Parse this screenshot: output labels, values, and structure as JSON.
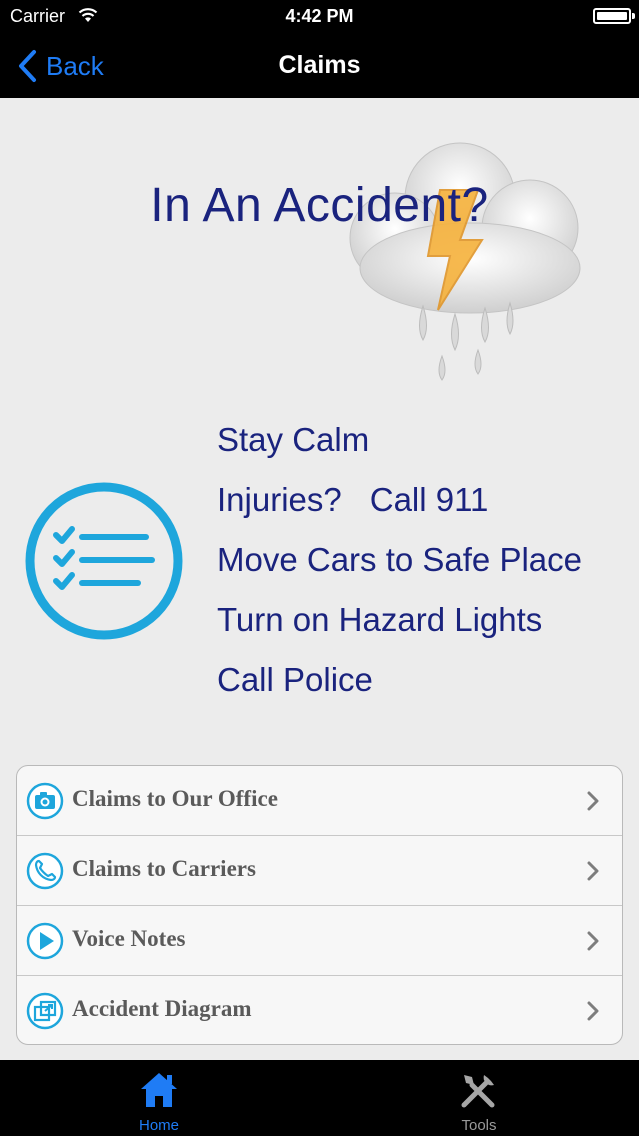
{
  "status_bar": {
    "carrier": "Carrier",
    "time": "4:42 PM",
    "wifi_icon": "wifi-icon",
    "battery_icon": "battery-icon"
  },
  "nav_bar": {
    "back_label": "Back",
    "title": "Claims"
  },
  "hero": {
    "title": "In An Accident?",
    "storm_icon": "storm-cloud-icon"
  },
  "tips": {
    "icon": "checklist-icon",
    "items": [
      {
        "text": "Stay Calm"
      },
      {
        "text": "Injuries?",
        "text2": "Call 911"
      },
      {
        "text": "Move Cars to Safe Place"
      },
      {
        "text": "Turn on Hazard Lights"
      },
      {
        "text": "Call Police"
      }
    ]
  },
  "menu": {
    "items": [
      {
        "label": "Claims to Our Office",
        "icon": "camera-icon"
      },
      {
        "label": "Claims to Carriers",
        "icon": "phone-icon"
      },
      {
        "label": "Voice Notes",
        "icon": "play-icon"
      },
      {
        "label": "Accident Diagram",
        "icon": "diagram-icon"
      }
    ]
  },
  "tab_bar": {
    "tabs": [
      {
        "label": "Home",
        "icon": "home-icon",
        "active": true
      },
      {
        "label": "Tools",
        "icon": "tools-icon",
        "active": false
      }
    ]
  },
  "colors": {
    "accent_blue": "#1f7cf5",
    "icon_cyan": "#1ea6dc",
    "heading_navy": "#1a237e",
    "content_bg": "#ececec"
  }
}
